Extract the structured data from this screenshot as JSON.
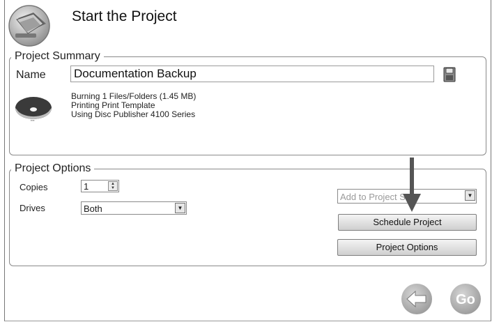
{
  "header": {
    "title": "Start the Project"
  },
  "summary": {
    "legend": "Project Summary",
    "name_label": "Name",
    "name_value": "Documentation Backup",
    "info_lines": [
      "Burning 1 Files/Folders (1.45 MB)",
      "Printing Print Template",
      "Using Disc Publisher 4100 Series"
    ]
  },
  "options": {
    "legend": "Project Options",
    "copies_label": "Copies",
    "copies_value": "1",
    "drives_label": "Drives",
    "drives_value": "Both",
    "add_to_project_placeholder": "Add to Project S",
    "schedule_button": "Schedule Project",
    "options_button": "Project Options"
  },
  "nav": {
    "back_icon": "arrow-left-icon",
    "go_label": "Go"
  },
  "icons": {
    "logo": "disc-folder-icon",
    "save": "floppy-disk-icon",
    "disc_preview": "disc-label-icon"
  },
  "colors": {
    "button_circle": "#a8a8a8",
    "accent_arrow": "#555555"
  }
}
